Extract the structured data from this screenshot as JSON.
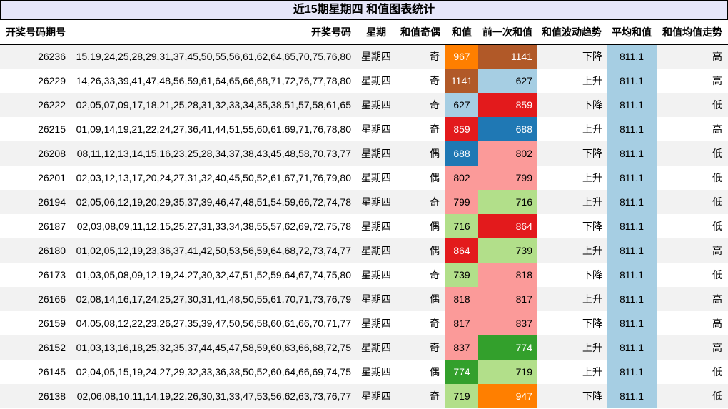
{
  "title": "近15期星期四 和值图表统计",
  "headers": {
    "issue": "开奖号码期号",
    "numbers": "开奖号码",
    "weekday": "星期",
    "odd_even": "和值奇偶",
    "sum": "和值",
    "prev_sum": "前一次和值",
    "trend": "和值波动趋势",
    "avg": "平均和值",
    "level": "和值均值走势"
  },
  "colors": {
    "c947": "#ff7f00",
    "c1141": "#b15928",
    "c627": "#a6cee3",
    "c859": "#e31a1c",
    "c688": "#1f78b4",
    "c802": "#fb9a99",
    "c799": "#fb9a99",
    "c716": "#b2df8a",
    "c864": "#e31a1c",
    "c739": "#b2df8a",
    "c818": "#fb9a99",
    "c817": "#fb9a99",
    "c837": "#fb9a99",
    "c774": "#33a02c",
    "c719": "#b2df8a",
    "c967": "#ff7f00",
    "avg_bg": "#a6cee3",
    "title_bg": "#e6e6fa"
  },
  "rows": [
    {
      "issue": "26236",
      "numbers": "15,19,24,25,28,29,31,37,45,50,55,56,61,62,64,65,70,75,76,80",
      "weekday": "星期四",
      "odd_even": "奇",
      "sum": "967",
      "prev_sum": "1141",
      "trend": "下降",
      "avg": "811.1",
      "level": "高"
    },
    {
      "issue": "26229",
      "numbers": "14,26,33,39,41,47,48,56,59,61,64,65,66,68,71,72,76,77,78,80",
      "weekday": "星期四",
      "odd_even": "奇",
      "sum": "1141",
      "prev_sum": "627",
      "trend": "上升",
      "avg": "811.1",
      "level": "高"
    },
    {
      "issue": "26222",
      "numbers": "02,05,07,09,17,18,21,25,28,31,32,33,34,35,38,51,57,58,61,65",
      "weekday": "星期四",
      "odd_even": "奇",
      "sum": "627",
      "prev_sum": "859",
      "trend": "下降",
      "avg": "811.1",
      "level": "低"
    },
    {
      "issue": "26215",
      "numbers": "01,09,14,19,21,22,24,27,36,41,44,51,55,60,61,69,71,76,78,80",
      "weekday": "星期四",
      "odd_even": "奇",
      "sum": "859",
      "prev_sum": "688",
      "trend": "上升",
      "avg": "811.1",
      "level": "高"
    },
    {
      "issue": "26208",
      "numbers": "08,11,12,13,14,15,16,23,25,28,34,37,38,43,45,48,58,70,73,77",
      "weekday": "星期四",
      "odd_even": "偶",
      "sum": "688",
      "prev_sum": "802",
      "trend": "下降",
      "avg": "811.1",
      "level": "低"
    },
    {
      "issue": "26201",
      "numbers": "02,03,12,13,17,20,24,27,31,32,40,45,50,52,61,67,71,76,79,80",
      "weekday": "星期四",
      "odd_even": "偶",
      "sum": "802",
      "prev_sum": "799",
      "trend": "上升",
      "avg": "811.1",
      "level": "低"
    },
    {
      "issue": "26194",
      "numbers": "02,05,06,12,19,20,29,35,37,39,46,47,48,51,54,59,66,72,74,78",
      "weekday": "星期四",
      "odd_even": "奇",
      "sum": "799",
      "prev_sum": "716",
      "trend": "上升",
      "avg": "811.1",
      "level": "低"
    },
    {
      "issue": "26187",
      "numbers": "02,03,08,09,11,12,15,25,27,31,33,34,38,55,57,62,69,72,75,78",
      "weekday": "星期四",
      "odd_even": "偶",
      "sum": "716",
      "prev_sum": "864",
      "trend": "下降",
      "avg": "811.1",
      "level": "低"
    },
    {
      "issue": "26180",
      "numbers": "01,02,05,12,19,23,36,37,41,42,50,53,56,59,64,68,72,73,74,77",
      "weekday": "星期四",
      "odd_even": "偶",
      "sum": "864",
      "prev_sum": "739",
      "trend": "上升",
      "avg": "811.1",
      "level": "高"
    },
    {
      "issue": "26173",
      "numbers": "01,03,05,08,09,12,19,24,27,30,32,47,51,52,59,64,67,74,75,80",
      "weekday": "星期四",
      "odd_even": "奇",
      "sum": "739",
      "prev_sum": "818",
      "trend": "下降",
      "avg": "811.1",
      "level": "低"
    },
    {
      "issue": "26166",
      "numbers": "02,08,14,16,17,24,25,27,30,31,41,48,50,55,61,70,71,73,76,79",
      "weekday": "星期四",
      "odd_even": "偶",
      "sum": "818",
      "prev_sum": "817",
      "trend": "上升",
      "avg": "811.1",
      "level": "高"
    },
    {
      "issue": "26159",
      "numbers": "04,05,08,12,22,23,26,27,35,39,47,50,56,58,60,61,66,70,71,77",
      "weekday": "星期四",
      "odd_even": "奇",
      "sum": "817",
      "prev_sum": "837",
      "trend": "下降",
      "avg": "811.1",
      "level": "高"
    },
    {
      "issue": "26152",
      "numbers": "01,03,13,16,18,25,32,35,37,44,45,47,58,59,60,63,66,68,72,75",
      "weekday": "星期四",
      "odd_even": "奇",
      "sum": "837",
      "prev_sum": "774",
      "trend": "上升",
      "avg": "811.1",
      "level": "高"
    },
    {
      "issue": "26145",
      "numbers": "02,04,05,15,19,24,27,29,32,33,36,38,50,52,60,64,66,69,74,75",
      "weekday": "星期四",
      "odd_even": "偶",
      "sum": "774",
      "prev_sum": "719",
      "trend": "上升",
      "avg": "811.1",
      "level": "低"
    },
    {
      "issue": "26138",
      "numbers": "02,06,08,10,11,14,19,22,26,30,31,33,47,53,56,62,63,73,76,77",
      "weekday": "星期四",
      "odd_even": "奇",
      "sum": "719",
      "prev_sum": "947",
      "trend": "下降",
      "avg": "811.1",
      "level": "低"
    }
  ]
}
